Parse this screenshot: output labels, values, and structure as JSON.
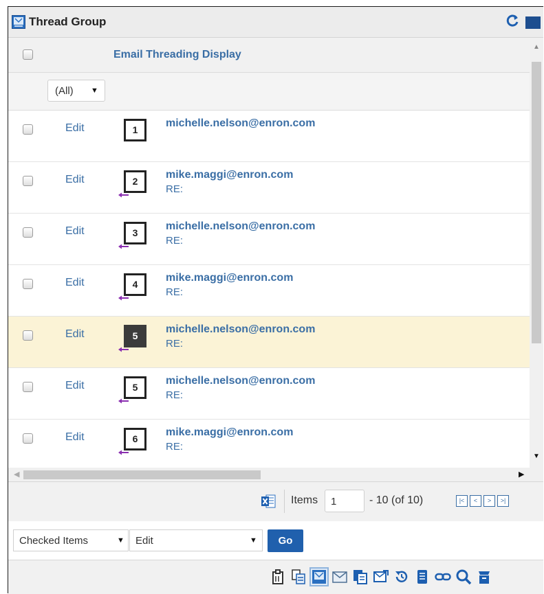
{
  "panel": {
    "title": "Thread Group",
    "title_icon": "thread-group-icon"
  },
  "grid": {
    "column_title": "Email Threading Display",
    "filter_value": "(All)",
    "rows": [
      {
        "action": "Edit",
        "number": "1",
        "sender": "michelle.nelson@enron.com",
        "subject": "",
        "highlighted": false
      },
      {
        "action": "Edit",
        "number": "2",
        "sender": "mike.maggi@enron.com",
        "subject": "RE:",
        "highlighted": false
      },
      {
        "action": "Edit",
        "number": "3",
        "sender": "michelle.nelson@enron.com",
        "subject": "RE:",
        "highlighted": false
      },
      {
        "action": "Edit",
        "number": "4",
        "sender": "mike.maggi@enron.com",
        "subject": "RE:",
        "highlighted": false
      },
      {
        "action": "Edit",
        "number": "5",
        "sender": "michelle.nelson@enron.com",
        "subject": "RE:",
        "highlighted": true
      },
      {
        "action": "Edit",
        "number": "5",
        "sender": "michelle.nelson@enron.com",
        "subject": "RE:",
        "highlighted": false
      },
      {
        "action": "Edit",
        "number": "6",
        "sender": "mike.maggi@enron.com",
        "subject": "RE:",
        "highlighted": false
      }
    ]
  },
  "pager": {
    "items_label": "Items",
    "current_page": "1",
    "range_text": "- 10 (of 10)"
  },
  "actions": {
    "scope": "Checked Items",
    "action": "Edit",
    "go_label": "Go"
  },
  "toolbar_icons": [
    "clipboard-icon",
    "copy-docs-icon",
    "thread-view-icon",
    "email-icon",
    "duplicate-icon",
    "email-forward-icon",
    "history-icon",
    "document-icon",
    "link-icon",
    "search-icon",
    "archive-icon"
  ],
  "colors": {
    "link": "#3a6ea5",
    "highlight_row": "#fbf3d6",
    "go_button": "#2060ad",
    "reply_arrow": "#8a2fb0"
  }
}
